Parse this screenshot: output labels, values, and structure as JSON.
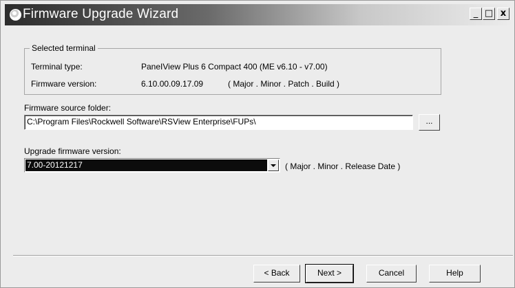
{
  "window": {
    "title": "Firmware Upgrade Wizard",
    "controls": {
      "minimize": "_",
      "maximize": "□",
      "close": "x"
    }
  },
  "selected_terminal": {
    "legend": "Selected terminal",
    "terminal_type_label": "Terminal type:",
    "terminal_type_value": "PaneIView Plus 6 Compact 400 (ME v6.10 - v7.00)",
    "firmware_version_label": "Firmware version:",
    "firmware_version_value": "6.10.00.09.17.09",
    "firmware_version_format": "( Major . Minor . Patch . Build )"
  },
  "source": {
    "label": "Firmware source folder:",
    "path": "C:\\Program Files\\Rockwell Software\\RSView Enterprise\\FUPs\\",
    "browse_label": "..."
  },
  "upgrade": {
    "label": "Upgrade firmware version:",
    "selected": "7.00-20121217",
    "format": "( Major . Minor . Release Date )"
  },
  "buttons": {
    "back": "< Back",
    "next": "Next >",
    "cancel": "Cancel",
    "help": "Help"
  },
  "icons": {
    "title": "globe-icon",
    "dropdown": "chevron-down-icon"
  }
}
